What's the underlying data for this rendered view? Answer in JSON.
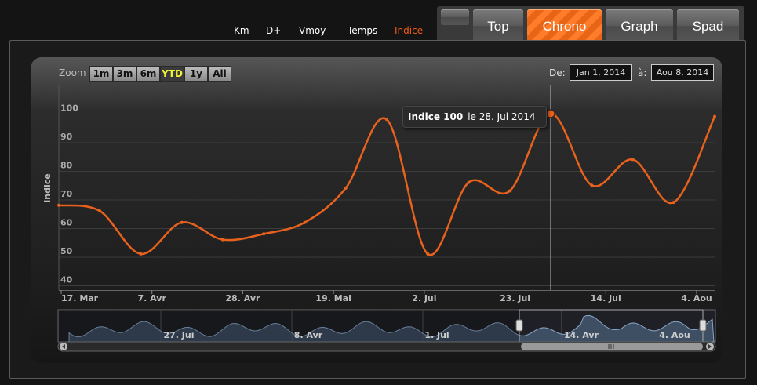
{
  "metrics": [
    {
      "label": "Km",
      "active": false
    },
    {
      "label": "D+",
      "active": false
    },
    {
      "label": "Vmoy",
      "active": false
    },
    {
      "label": "Temps",
      "active": false
    },
    {
      "label": "Indice",
      "active": true
    }
  ],
  "tabs": [
    {
      "label": "",
      "active": false
    },
    {
      "label": "Top",
      "active": false
    },
    {
      "label": "Chrono",
      "active": true
    },
    {
      "label": "Graph",
      "active": false
    },
    {
      "label": "Spad",
      "active": false
    }
  ],
  "zoom": {
    "label": "Zoom",
    "buttons": [
      {
        "label": "1m",
        "active": false
      },
      {
        "label": "3m",
        "active": false
      },
      {
        "label": "6m",
        "active": false
      },
      {
        "label": "YTD",
        "active": true
      },
      {
        "label": "1y",
        "active": false
      },
      {
        "label": "All",
        "active": false
      }
    ]
  },
  "range": {
    "from_label": "De:",
    "from_value": "Jan 1, 2014",
    "to_label": "à:",
    "to_value": "Aou 8, 2014"
  },
  "tooltip": {
    "series": "Indice 100",
    "date": "le 28. Jui 2014"
  },
  "chart_data": {
    "type": "line",
    "ylabel": "Indice",
    "xlabel": "",
    "ylim": [
      40,
      105
    ],
    "yticks": [
      40,
      50,
      60,
      70,
      80,
      90,
      100
    ],
    "x_tick_labels": [
      "17. Mar",
      "7. Avr",
      "28. Avr",
      "19. Mai",
      "2. Jui",
      "23. Jui",
      "14. Jui",
      "4. Aou"
    ],
    "color": "#e8621e",
    "grid": true,
    "points": [
      68,
      66,
      51,
      62,
      56,
      58,
      62,
      74,
      98,
      51,
      76,
      73,
      100,
      75,
      84,
      69,
      99
    ],
    "highlight_index": 12,
    "navigator": {
      "labels": [
        "27. Jui",
        "8. Avr",
        "1. Jul",
        "14. Avr",
        "4. Aou"
      ]
    }
  }
}
